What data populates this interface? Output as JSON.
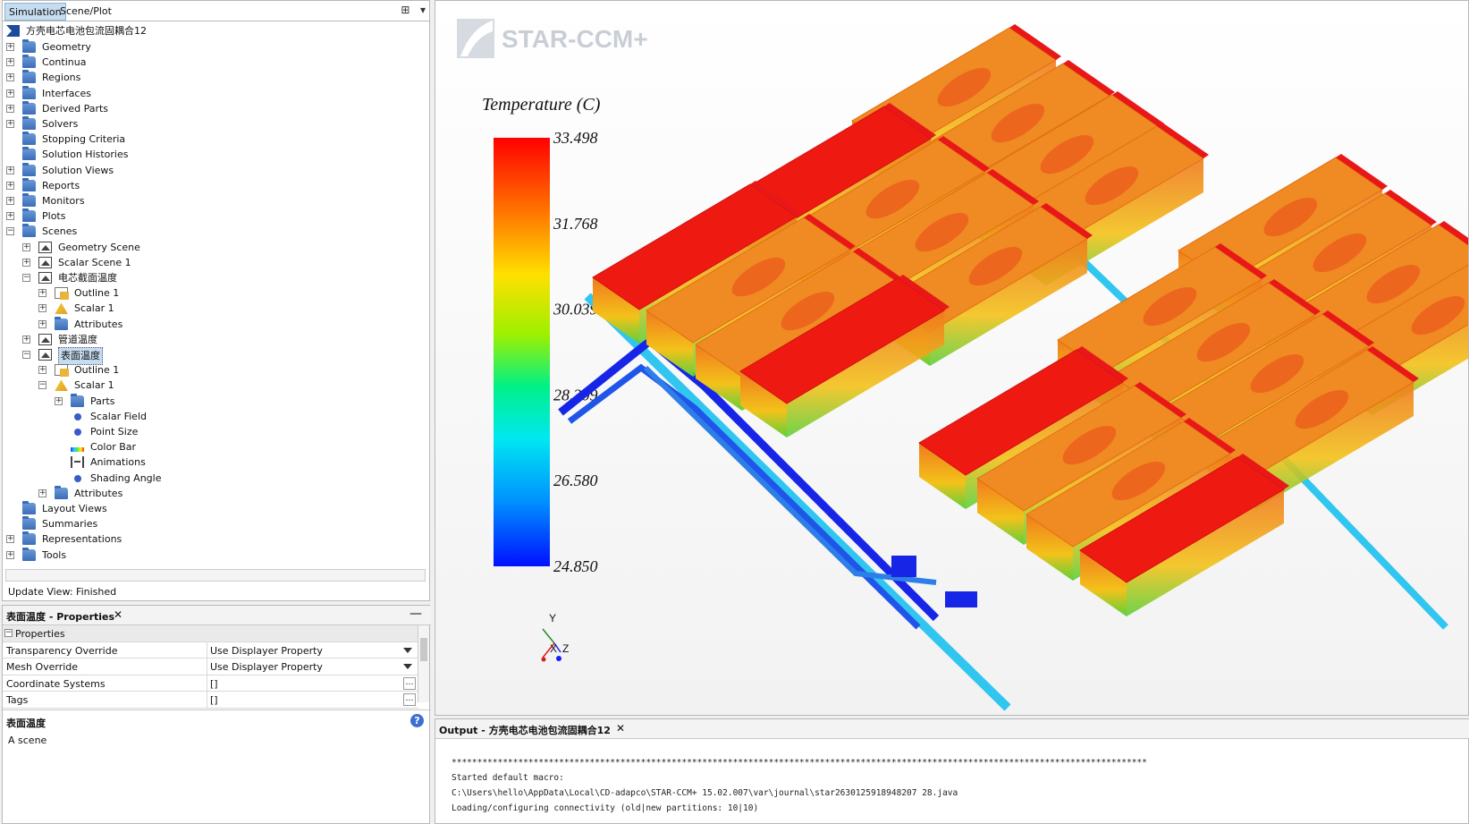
{
  "tabs": {
    "simulation": "Simulation",
    "scene_plot": "Scene/Plot"
  },
  "tree": {
    "root": "方壳电芯电池包流固耦合12",
    "nodes": [
      {
        "label": "Geometry",
        "icon": "folder-icon"
      },
      {
        "label": "Continua",
        "icon": "folder-icon"
      },
      {
        "label": "Regions",
        "icon": "folder-icon"
      },
      {
        "label": "Interfaces",
        "icon": "folder-icon"
      },
      {
        "label": "Derived Parts",
        "icon": "folder-icon"
      },
      {
        "label": "Solvers",
        "icon": "folder-icon"
      },
      {
        "label": "Stopping Criteria",
        "icon": "folder-icon"
      },
      {
        "label": "Solution Histories",
        "icon": "folder-icon"
      },
      {
        "label": "Solution Views",
        "icon": "folder-icon"
      },
      {
        "label": "Reports",
        "icon": "folder-icon"
      },
      {
        "label": "Monitors",
        "icon": "folder-icon"
      },
      {
        "label": "Plots",
        "icon": "folder-icon"
      },
      {
        "label": "Scenes",
        "icon": "folder-icon"
      },
      {
        "label": "Geometry Scene",
        "icon": "scene-icon"
      },
      {
        "label": "Scalar Scene 1",
        "icon": "scene-icon"
      },
      {
        "label": "电芯截面温度",
        "icon": "scene-icon"
      },
      {
        "label": "Outline 1",
        "icon": "outline-icon"
      },
      {
        "label": "Scalar 1",
        "icon": "scalar-icon"
      },
      {
        "label": "Attributes",
        "icon": "folder-icon"
      },
      {
        "label": "管道温度",
        "icon": "scene-icon"
      },
      {
        "label": "表面温度",
        "icon": "scene-icon"
      },
      {
        "label": "Outline 1",
        "icon": "outline-icon"
      },
      {
        "label": "Scalar 1",
        "icon": "scalar-icon"
      },
      {
        "label": "Parts",
        "icon": "folder-icon"
      },
      {
        "label": "Scalar Field",
        "icon": "dot-icon"
      },
      {
        "label": "Point Size",
        "icon": "dot-icon"
      },
      {
        "label": "Color Bar",
        "icon": "colorbar-icon"
      },
      {
        "label": "Animations",
        "icon": "animation-icon"
      },
      {
        "label": "Shading Angle",
        "icon": "dot-icon"
      },
      {
        "label": "Attributes",
        "icon": "folder-icon"
      },
      {
        "label": "Layout Views",
        "icon": "folder-icon"
      },
      {
        "label": "Summaries",
        "icon": "folder-icon"
      },
      {
        "label": "Representations",
        "icon": "folder-icon"
      },
      {
        "label": "Tools",
        "icon": "folder-icon"
      }
    ]
  },
  "status": "Update View: Finished",
  "properties": {
    "tab_title": "表面温度 - Properties",
    "section": "Properties",
    "rows": [
      {
        "key": "Transparency Override",
        "value": "Use Displayer Property"
      },
      {
        "key": "Mesh Override",
        "value": "Use Displayer Property"
      },
      {
        "key": "Coordinate Systems",
        "value": "[]"
      },
      {
        "key": "Tags",
        "value": "[]"
      }
    ],
    "description_title": "表面温度",
    "description_text": "A scene"
  },
  "viewport": {
    "logo_text": "STAR-CCM+",
    "colorbar": {
      "title": "Temperature (C)",
      "ticks": [
        "33.498",
        "31.768",
        "30.039",
        "28.309",
        "26.580",
        "24.850"
      ]
    },
    "axes": {
      "y": "Y",
      "x": "X",
      "z": "Z"
    }
  },
  "output": {
    "tab_title": "Output - 方壳电芯电池包流固耦合12",
    "lines": [
      "****************************************************************************************************************************************",
      "Started default macro:",
      "C:\\Users\\hello\\AppData\\Local\\CD-adapco\\STAR-CCM+ 15.02.007\\var\\journal\\star2630125918948207 28.java",
      "Loading/configuring connectivity (old|new partitions: 10|10)"
    ]
  },
  "colors": {
    "hot": "#ee1a12",
    "warm": "#f08a22",
    "cold": "#1726e6",
    "pipe_light": "#31c6f0",
    "accent": "#c6dcef"
  }
}
